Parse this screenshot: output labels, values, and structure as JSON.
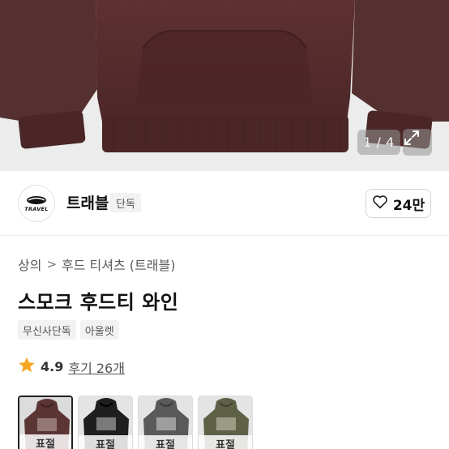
{
  "hero": {
    "counter": "1 / 4",
    "expand_icon": "expand-icon",
    "product_color": "#5a2e2f"
  },
  "brand": {
    "logo_wordmark": "TRAVEL",
    "name": "트래블",
    "tag": "단독",
    "like_icon": "heart-outline-icon",
    "like_count": "24만"
  },
  "breadcrumb": {
    "items": [
      "상의",
      "후드 티셔츠 (트래블)"
    ],
    "separator": ">"
  },
  "product": {
    "title": "스모크 후드티 와인",
    "tags": [
      "무신사단독",
      "아울렛"
    ]
  },
  "rating": {
    "star_icon": "star-icon",
    "star_color": "#f5a623",
    "value": "4.9",
    "review_text": "후기 26개"
  },
  "variants": [
    {
      "label": "표절",
      "color": "#5b3534",
      "selected": true
    },
    {
      "label": "표절",
      "color": "#1f1f1f",
      "selected": false
    },
    {
      "label": "표절",
      "color": "#5a5a5a",
      "selected": false
    },
    {
      "label": "표절",
      "color": "#5f6147",
      "selected": false
    }
  ]
}
